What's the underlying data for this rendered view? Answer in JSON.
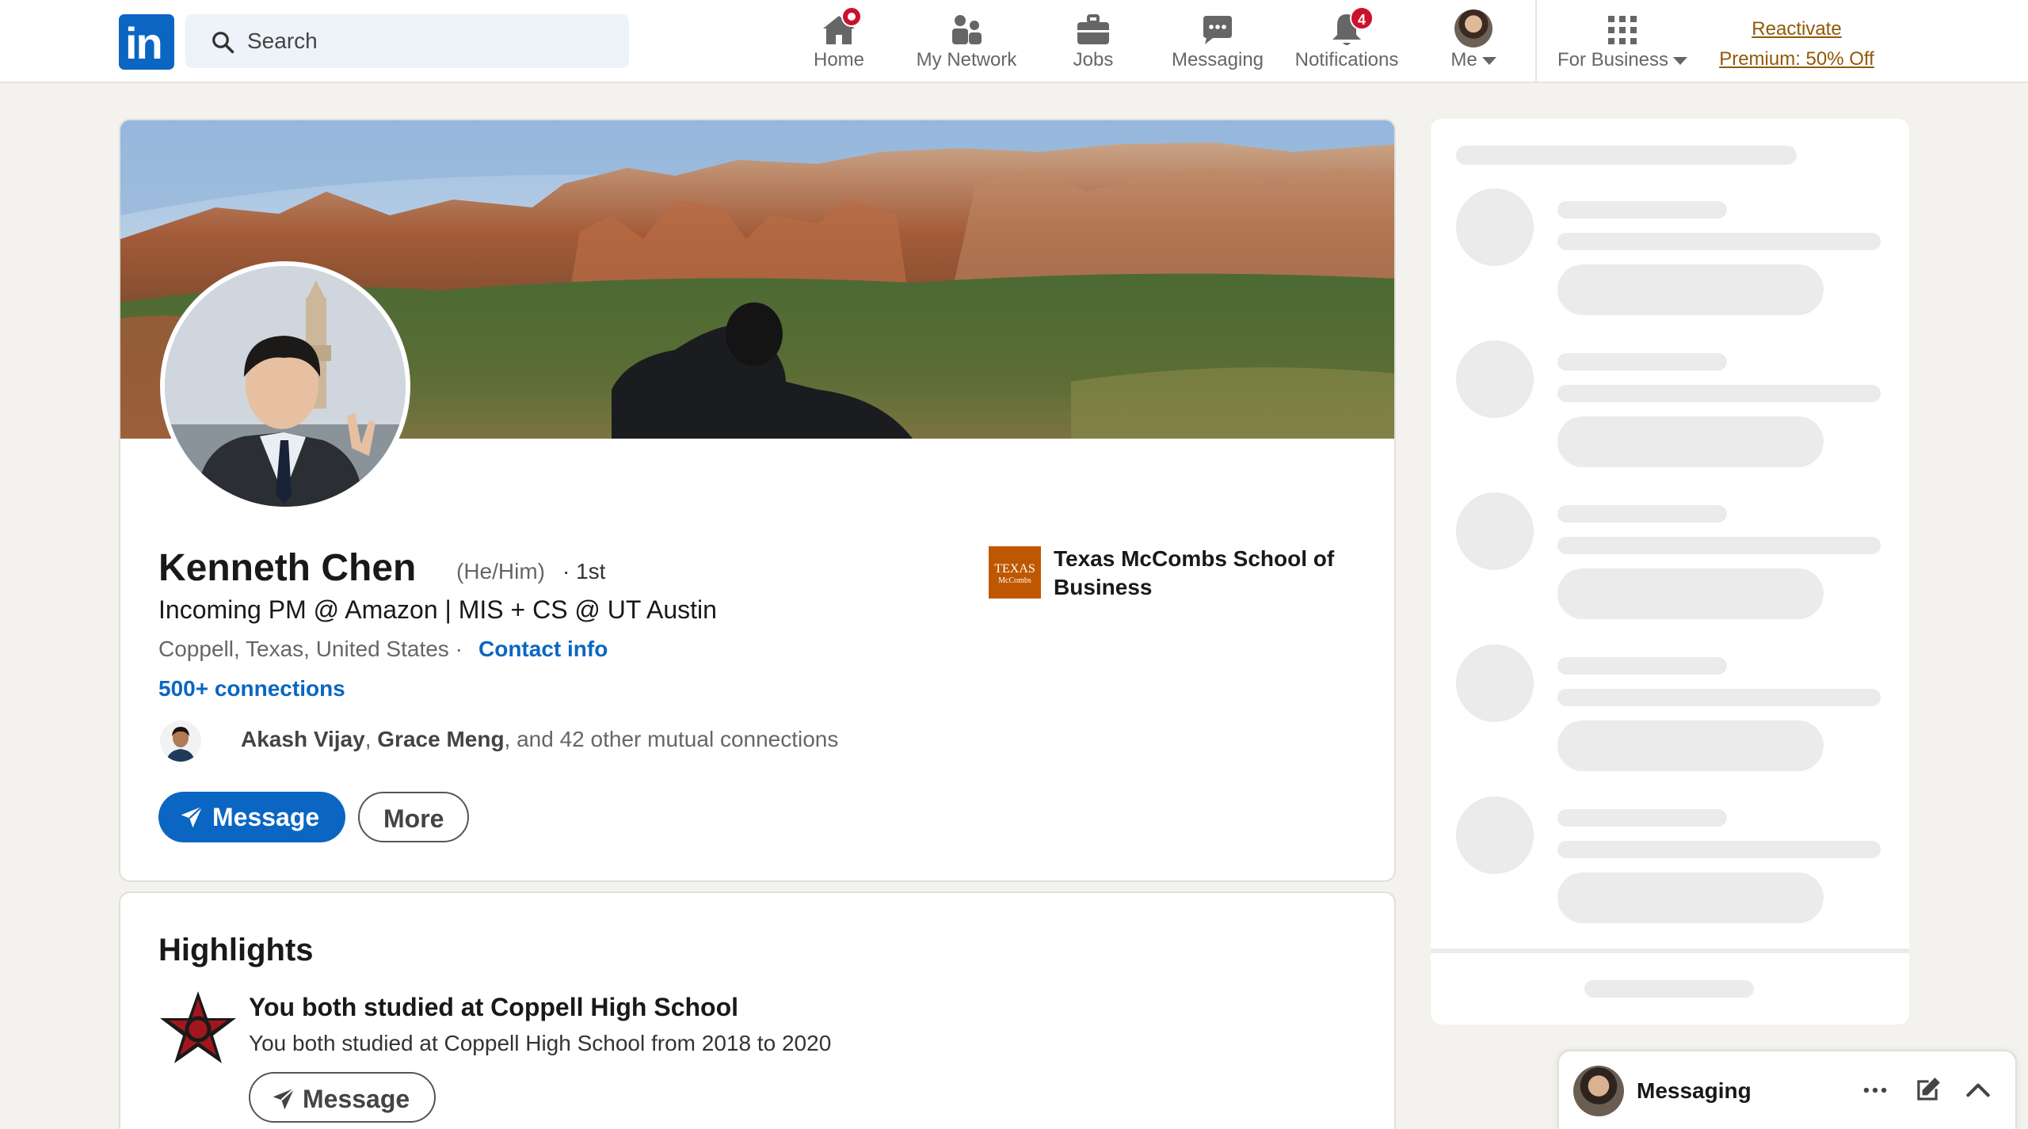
{
  "nav": {
    "logo_text": "in",
    "search_placeholder": "Search",
    "items": [
      {
        "label": "Home"
      },
      {
        "label": "My Network"
      },
      {
        "label": "Jobs"
      },
      {
        "label": "Messaging"
      },
      {
        "label": "Notifications",
        "badge": "4"
      },
      {
        "label": "Me"
      },
      {
        "label": "For Business"
      }
    ],
    "premium_line1": "Reactivate",
    "premium_line2": "Premium: 50% Off"
  },
  "profile": {
    "name": "Kenneth Chen",
    "pronouns": "(He/Him)",
    "degree": "· 1st",
    "headline": "Incoming PM @ Amazon | MIS + CS @ UT Austin",
    "location": "Coppell, Texas, United States ·",
    "contact_info": "Contact info",
    "connections": "500+ connections",
    "mutual_names_1": "Akash Vijay",
    "mutual_sep": ", ",
    "mutual_names_2": "Grace Meng",
    "mutual_rest": ", and 42 other mutual connections",
    "message_button": "Message",
    "more_button": "More",
    "school_logo_text_1": "TEXAS",
    "school_logo_text_2": "McCombs",
    "school_name": "Texas McCombs School of Business"
  },
  "highlights": {
    "title": "Highlights",
    "heading": "You both studied at Coppell High School",
    "subtext": "You both studied at Coppell High School from 2018 to 2020",
    "message_button": "Message"
  },
  "messaging_bar": {
    "title": "Messaging"
  },
  "colors": {
    "brand_blue": "#0a66c2",
    "badge_red": "#cb112d",
    "premium_gold": "#915907",
    "page_bg": "#f4f2ee"
  }
}
